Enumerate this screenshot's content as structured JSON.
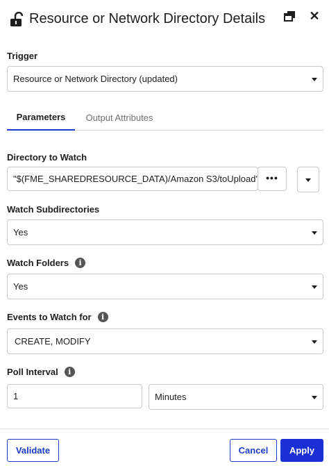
{
  "header": {
    "title": "Resource or Network Directory Details",
    "lock_icon": "unlock-icon",
    "popout_icon": "popout-window-icon",
    "close_icon": "close-icon",
    "close_glyph": "✕"
  },
  "trigger": {
    "label": "Trigger",
    "value": "Resource or Network Directory (updated)"
  },
  "tabs": [
    {
      "label": "Parameters",
      "active": true
    },
    {
      "label": "Output Attributes",
      "active": false
    }
  ],
  "directory": {
    "label": "Directory to Watch",
    "value": "\"$(FME_SHAREDRESOURCE_DATA)/Amazon S3/toUpload\"",
    "browse_label": "•••"
  },
  "watch_subdirectories": {
    "label": "Watch Subdirectories",
    "value": "Yes"
  },
  "watch_folders": {
    "label": "Watch Folders",
    "value": "Yes",
    "info_icon": "info-icon"
  },
  "events": {
    "label": "Events to Watch for",
    "value": "CREATE,  MODIFY",
    "info_icon": "info-icon"
  },
  "poll_interval": {
    "label": "Poll Interval",
    "value": "1",
    "unit": "Minutes",
    "info_icon": "info-icon"
  },
  "footer": {
    "validate_label": "Validate",
    "cancel_label": "Cancel",
    "apply_label": "Apply"
  },
  "colors": {
    "accent": "#1a3cc8",
    "primary_button": "#1a2fd6",
    "border": "#c8c8c8",
    "text": "#1e1e1e",
    "muted_text": "#6f6f6f"
  }
}
